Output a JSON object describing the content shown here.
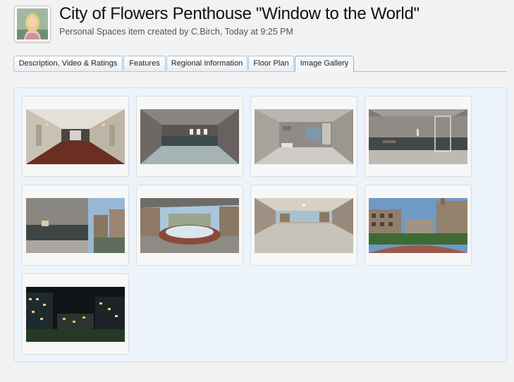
{
  "header": {
    "avatar_alt": "User avatar",
    "title": "City of Flowers Penthouse \"Window to the World\"",
    "subtitle": "Personal Spaces item created by C.Birch, Today at 9:25 PM"
  },
  "tabs": [
    {
      "label": "Description, Video & Ratings",
      "active": false
    },
    {
      "label": "Features",
      "active": false
    },
    {
      "label": "Regional Information",
      "active": false
    },
    {
      "label": "Floor Plan",
      "active": false
    },
    {
      "label": "Image Gallery",
      "active": true
    }
  ],
  "gallery": {
    "images": [
      {
        "name": "penthouse-hallway"
      },
      {
        "name": "empty-room-windows"
      },
      {
        "name": "bathroom-sink-view"
      },
      {
        "name": "bathroom-shower"
      },
      {
        "name": "room-window-city"
      },
      {
        "name": "hot-tub-panorama"
      },
      {
        "name": "terrace-room"
      },
      {
        "name": "city-view-day"
      },
      {
        "name": "city-view-night"
      }
    ]
  }
}
